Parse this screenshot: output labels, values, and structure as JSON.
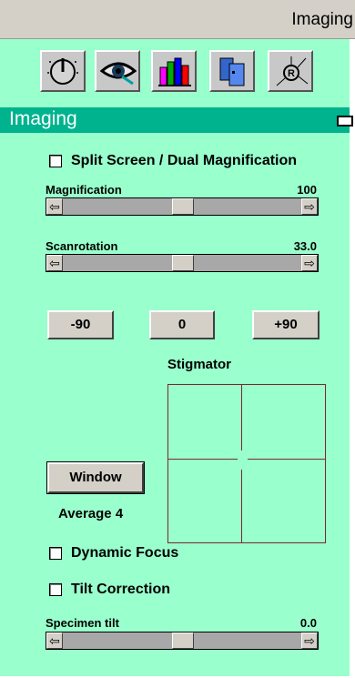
{
  "window": {
    "title": "Imaging"
  },
  "toolbar": {
    "icons": [
      "knob-icon",
      "eye-icon",
      "bar-chart-icon",
      "split-window-icon",
      "rotation-axes-icon"
    ]
  },
  "section": {
    "title": "Imaging"
  },
  "split_screen": {
    "label": "Split Screen / Dual Magnification",
    "checked": false
  },
  "magnification": {
    "label": "Magnification",
    "value": "100",
    "position_fraction": 0.5
  },
  "scanrotation": {
    "label": "Scanrotation",
    "value": "33.0",
    "position_fraction": 0.5
  },
  "rotation_buttons": {
    "minus90": "-90",
    "zero": "0",
    "plus90": "+90"
  },
  "stigmator": {
    "label": "Stigmator"
  },
  "window_button": {
    "label": "Window"
  },
  "average": {
    "label": "Average 4"
  },
  "dynamic_focus": {
    "label": "Dynamic Focus",
    "checked": false
  },
  "tilt_correction": {
    "label": "Tilt Correction",
    "checked": false
  },
  "specimen_tilt": {
    "label": "Specimen tilt",
    "value": "0.0",
    "position_fraction": 0.5
  },
  "arrows": {
    "left": "⇦",
    "right": "⇨"
  },
  "colors": {
    "panel": "#99ffcc",
    "header": "#00b38f",
    "stigmator_border": "#7a2a2a"
  }
}
